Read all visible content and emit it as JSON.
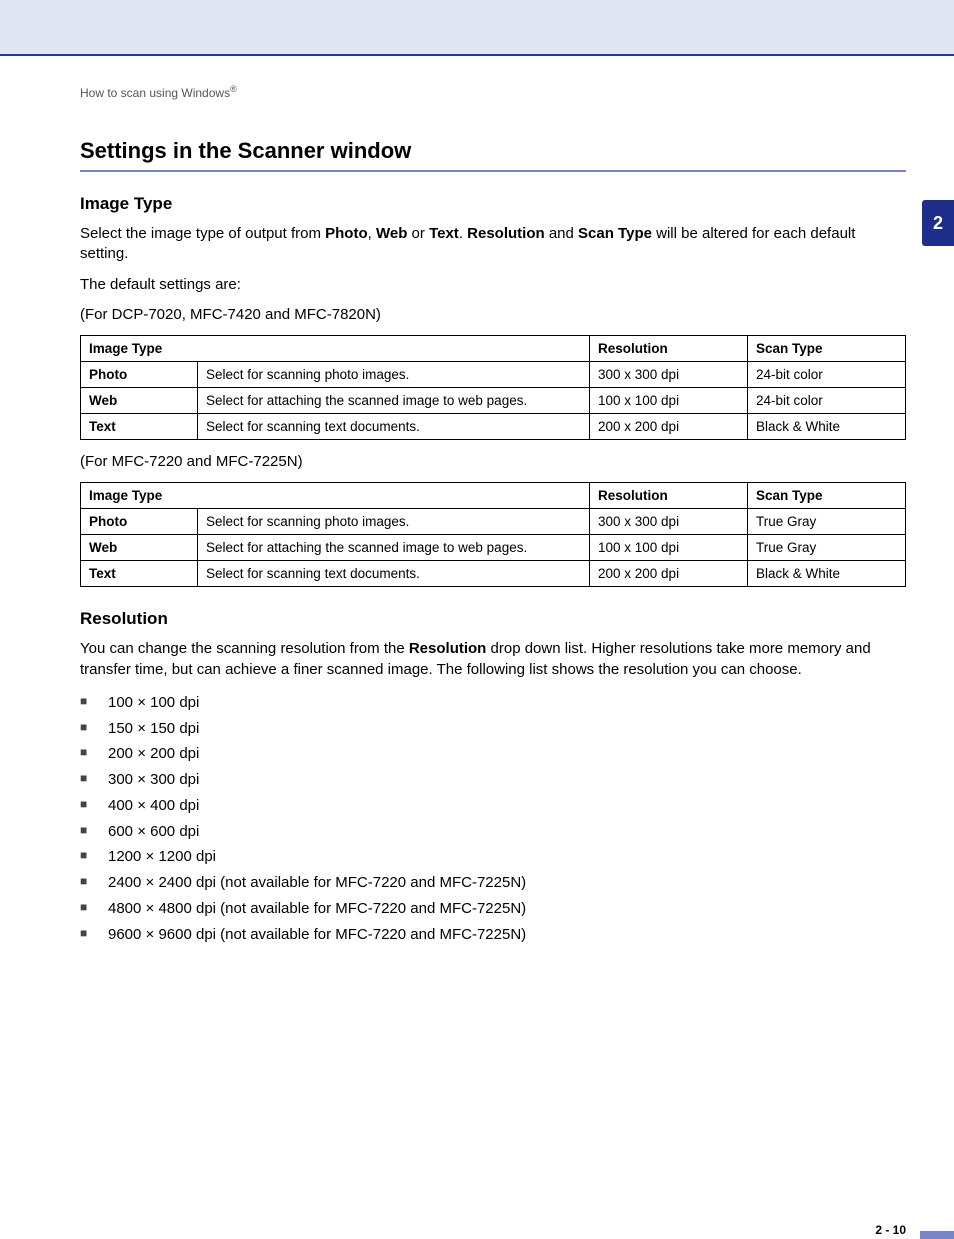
{
  "breadcrumb": {
    "text": "How to scan using Windows",
    "trademark": "®"
  },
  "chapter_tab": "2",
  "section_title": "Settings in the Scanner window",
  "image_type": {
    "heading": "Image Type",
    "intro_parts": {
      "p1": "Select the image type of output from ",
      "b1": "Photo",
      "s1": ", ",
      "b2": "Web",
      "s2": " or ",
      "b3": "Text",
      "s3": ". ",
      "b4": "Resolution",
      "s4": " and ",
      "b5": "Scan Type",
      "s5": " will be altered for each default setting."
    },
    "defaults_label": "The default settings are:",
    "table1_caption": "(For DCP-7020, MFC-7420 and MFC-7820N)",
    "table2_caption": "(For MFC-7220 and MFC-7225N)",
    "headers": {
      "c1": "Image Type",
      "c2": "Resolution",
      "c3": "Scan Type"
    },
    "table1": [
      {
        "type": "Photo",
        "desc": "Select for scanning photo images.",
        "res": "300 x 300 dpi",
        "scan": "24-bit color"
      },
      {
        "type": "Web",
        "desc": "Select for attaching the scanned image to web pages.",
        "res": "100 x 100 dpi",
        "scan": "24-bit color"
      },
      {
        "type": "Text",
        "desc": "Select for scanning text documents.",
        "res": "200 x 200 dpi",
        "scan": "Black & White"
      }
    ],
    "table2": [
      {
        "type": "Photo",
        "desc": "Select for scanning photo images.",
        "res": "300 x 300 dpi",
        "scan": "True Gray"
      },
      {
        "type": "Web",
        "desc": "Select for attaching the scanned image to web pages.",
        "res": "100 x 100 dpi",
        "scan": "True Gray"
      },
      {
        "type": "Text",
        "desc": "Select for scanning text documents.",
        "res": "200 x 200 dpi",
        "scan": "Black & White"
      }
    ]
  },
  "resolution": {
    "heading": "Resolution",
    "intro_parts": {
      "p1": "You can change the scanning resolution from the ",
      "b1": "Resolution",
      "p2": " drop down list. Higher resolutions take more memory and transfer time, but can achieve a finer scanned image. The following list shows the resolution you can choose."
    },
    "items": [
      "100 × 100 dpi",
      "150 × 150 dpi",
      "200 × 200 dpi",
      "300 × 300 dpi",
      "400 × 400 dpi",
      "600 × 600 dpi",
      "1200 × 1200 dpi",
      "2400 × 2400 dpi (not available for MFC-7220 and MFC-7225N)",
      "4800 × 4800 dpi (not available for MFC-7220 and MFC-7225N)",
      "9600 × 9600 dpi (not available for MFC-7220 and MFC-7225N)"
    ]
  },
  "page_number": "2 - 10"
}
